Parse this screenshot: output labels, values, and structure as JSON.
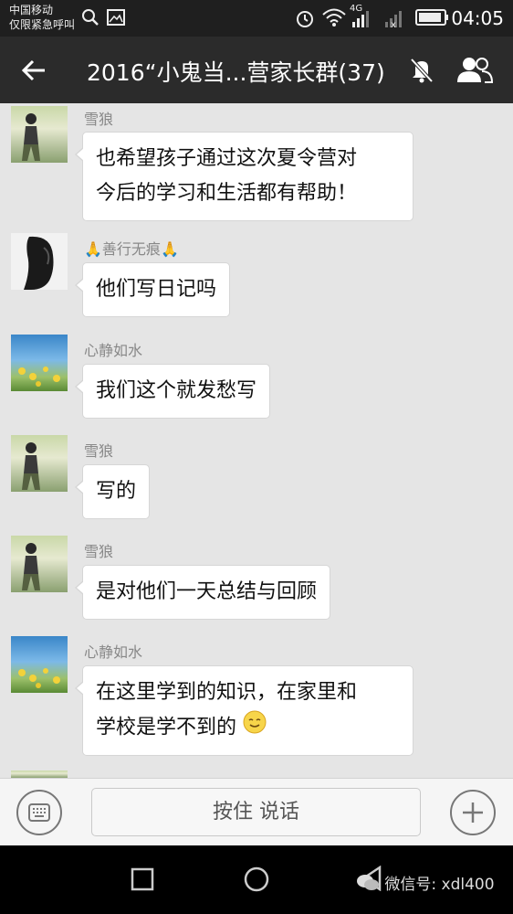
{
  "status_bar": {
    "carrier_line1": "中国移动",
    "carrier_line2": "仅限紧急呼叫",
    "network": "4G",
    "time": "04:05"
  },
  "header": {
    "title": "2016“小鬼当...营家长群(37)"
  },
  "messages": [
    {
      "sender": "雪狼",
      "lines": [
        "也希望孩子通过这次夏令营对",
        "今后的学习和生活都有帮助！"
      ]
    },
    {
      "sender": "善行无痕",
      "text": "他们写日记吗"
    },
    {
      "sender": "心静如水",
      "text": "我们这个就发愁写"
    },
    {
      "sender": "雪狼",
      "text": "写的"
    },
    {
      "sender": "雪狼",
      "text": "是对他们一天总结与回顾"
    },
    {
      "sender": "心静如水",
      "lines": [
        "在这里学到的知识，在家里和",
        "学校是学不到的"
      ]
    }
  ],
  "input_bar": {
    "hold_to_talk": "按住 说话"
  },
  "watermark": {
    "text": "微信号: xdl400"
  },
  "icons": {
    "back": "back-arrow-icon",
    "mute": "mute-bell-icon",
    "members": "group-members-icon",
    "keyboard": "keyboard-icon",
    "plus": "plus-icon",
    "smiley": "smiley-emoji-icon",
    "pray": "pray-hands-icon"
  },
  "colors": {
    "header_bg": "#2b2b2b",
    "chat_bg": "#e5e5e5",
    "bubble_bg": "#ffffff"
  }
}
